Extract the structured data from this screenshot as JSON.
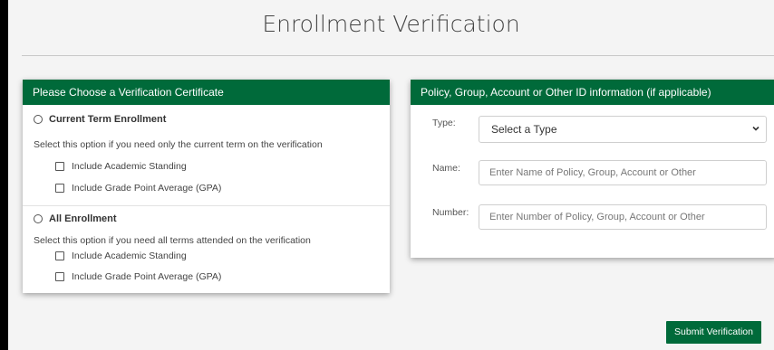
{
  "page_title": "Enrollment Verification",
  "certificate_card": {
    "header": "Please Choose a Verification Certificate",
    "options": [
      {
        "label": "Current Term Enrollment",
        "description": "Select this option if you need only the current term on the verification",
        "checkboxes": [
          "Include Academic Standing",
          "Include Grade Point Average (GPA)"
        ]
      },
      {
        "label": "All Enrollment",
        "description": "Select this option if you need all terms attended on the verification",
        "checkboxes": [
          "Include Academic Standing",
          "Include Grade Point Average (GPA)"
        ]
      }
    ]
  },
  "policy_card": {
    "header": "Policy, Group, Account or Other ID information (if applicable)",
    "type_label": "Type:",
    "type_selected": "Select a Type",
    "name_label": "Name:",
    "name_placeholder": "Enter Name of Policy, Group, Account or Other",
    "number_label": "Number:",
    "number_placeholder": "Enter Number of Policy, Group, Account or Other"
  },
  "submit_label": "Submit Verification",
  "colors": {
    "brand_green": "#006a3a"
  },
  "icons": {
    "select": "chevron-down-icon"
  }
}
